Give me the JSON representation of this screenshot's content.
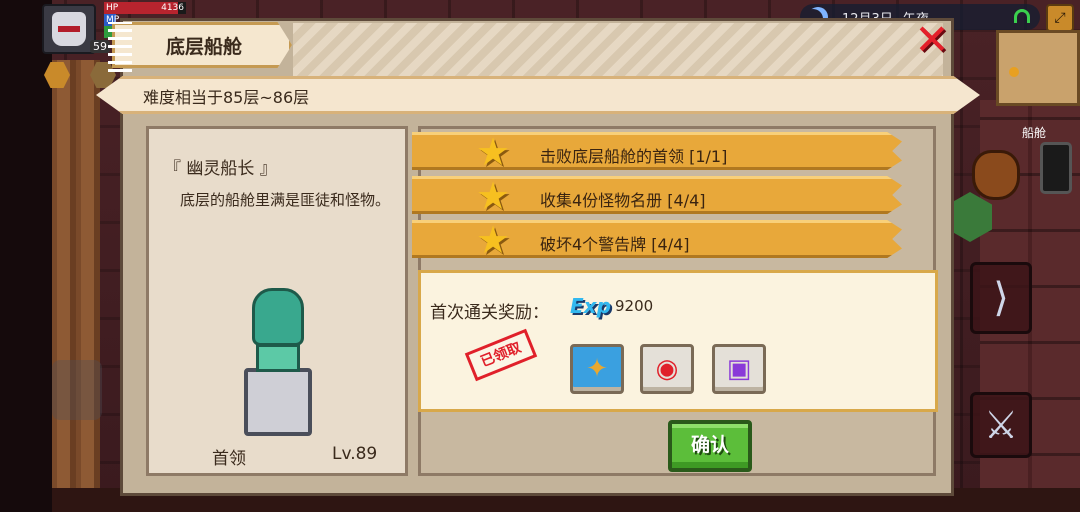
{
  "hud": {
    "hp_label": "HP",
    "hp_value": "4136",
    "hp_fill_fraction": 0.9,
    "mp_label": "MP",
    "player_level": "59",
    "avatar_icon": "knight-helmet-icon"
  },
  "status": {
    "date": "12月3日",
    "period": "午夜",
    "moon_icon": "moon-icon",
    "wifi_icon": "wifi-icon"
  },
  "world": {
    "location_label": "船舱"
  },
  "dialog": {
    "title": "底层船舱",
    "difficulty": "难度相当于85层~86层",
    "close_icon": "close-icon",
    "boss": {
      "name": "『 幽灵船长 』",
      "description": "底层的船舱里满是匪徒和怪物。",
      "label": "首领",
      "level": "Lv.89",
      "icon": "ghost-captain-statue-icon"
    },
    "tasks": [
      {
        "text": "击败底层船舱的首领 [1/1]",
        "icon": "star-icon"
      },
      {
        "text": "收集4份怪物名册 [4/4]",
        "icon": "star-icon"
      },
      {
        "text": "破坏4个警告牌 [4/4]",
        "icon": "star-icon"
      }
    ],
    "rewards": {
      "label": "首次通关奖励：",
      "exp_icon_text": "Exp",
      "exp_value": "9200",
      "claimed_stamp": "已领取",
      "items": [
        {
          "icon": "scroll-key-icon",
          "glyph": "✦"
        },
        {
          "icon": "red-trophy-icon",
          "glyph": "◉"
        },
        {
          "icon": "purple-chest-icon",
          "glyph": "▣"
        }
      ]
    },
    "confirm_label": "确认"
  },
  "colors": {
    "accent_gold": "#e8a83a",
    "confirm_green": "#5cbe3a",
    "close_red": "#e4202a",
    "stamp_red": "#e0202a"
  }
}
